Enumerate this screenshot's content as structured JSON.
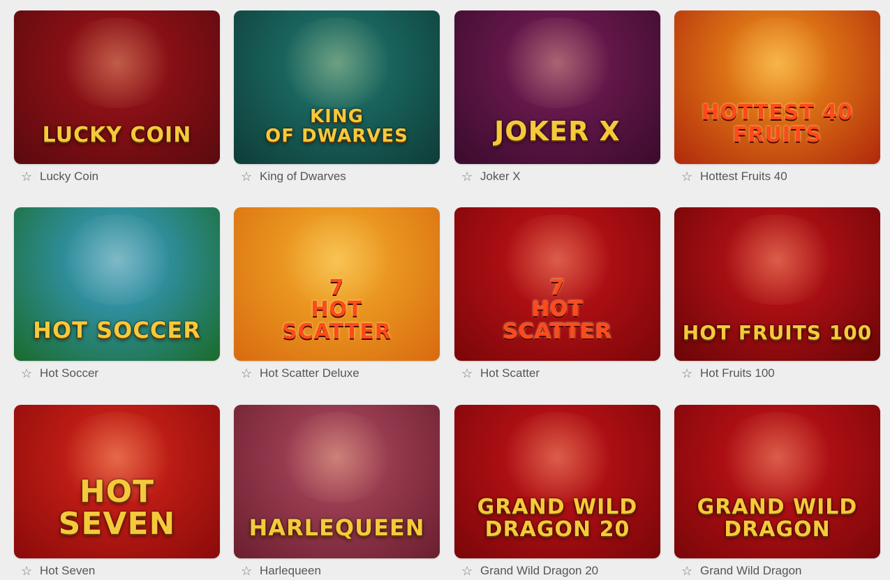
{
  "games": [
    {
      "title": "Lucky Coin",
      "logo_lines": [
        "LUCKY COIN"
      ],
      "colors": [
        "#a0131a",
        "#5a0a0e"
      ],
      "logo_style": "gold",
      "logo_size": 30
    },
    {
      "title": "King of Dwarves",
      "logo_lines": [
        "KING",
        "OF DWARVES"
      ],
      "colors": [
        "#1f7a72",
        "#0f3c38"
      ],
      "logo_style": "gold",
      "logo_size": 26
    },
    {
      "title": "Joker X",
      "logo_lines": [
        "JOKER X"
      ],
      "colors": [
        "#7a1e5a",
        "#3a0b2c"
      ],
      "logo_style": "gold",
      "logo_size": 38
    },
    {
      "title": "Hottest Fruits 40",
      "logo_lines": [
        "HOTTEST 40",
        "FRUITS"
      ],
      "colors": [
        "#f39a1a",
        "#b0280b"
      ],
      "logo_style": "red",
      "logo_size": 30
    },
    {
      "title": "Hot Soccer",
      "logo_lines": [
        "HOT SOCCER"
      ],
      "colors": [
        "#3aa0d8",
        "#1a6b2a"
      ],
      "logo_style": "gold",
      "logo_size": 32
    },
    {
      "title": "Hot Scatter Deluxe",
      "logo_lines": [
        "7",
        "HOT",
        "SCATTER"
      ],
      "colors": [
        "#f4b02a",
        "#d86a10"
      ],
      "logo_style": "red",
      "logo_size": 30
    },
    {
      "title": "Hot Scatter",
      "logo_lines": [
        "7",
        "HOT",
        "SCATTER"
      ],
      "colors": [
        "#c8141a",
        "#7a0608"
      ],
      "logo_style": "red",
      "logo_size": 30
    },
    {
      "title": "Hot Fruits 100",
      "logo_lines": [
        "HOT FRUITS 100"
      ],
      "colors": [
        "#c8141a",
        "#6a0507"
      ],
      "logo_style": "gold",
      "logo_size": 28
    },
    {
      "title": "Hot Seven",
      "logo_lines": [
        "HOT",
        "SEVEN"
      ],
      "colors": [
        "#d8261a",
        "#8a0a0a"
      ],
      "logo_style": "gold",
      "logo_size": 44
    },
    {
      "title": "Harlequeen",
      "logo_lines": [
        "HARLEQUEEN"
      ],
      "colors": [
        "#b04a62",
        "#6a1f2e"
      ],
      "logo_style": "gold",
      "logo_size": 32
    },
    {
      "title": "Grand Wild Dragon 20",
      "logo_lines": [
        "GRAND WILD",
        "DRAGON 20"
      ],
      "colors": [
        "#c8141a",
        "#7a0608"
      ],
      "logo_style": "gold",
      "logo_size": 30
    },
    {
      "title": "Grand Wild Dragon",
      "logo_lines": [
        "GRAND WILD",
        "DRAGON"
      ],
      "colors": [
        "#c8141a",
        "#7a0608"
      ],
      "logo_style": "gold",
      "logo_size": 30
    }
  ],
  "favorite_icon": "star-outline-icon"
}
